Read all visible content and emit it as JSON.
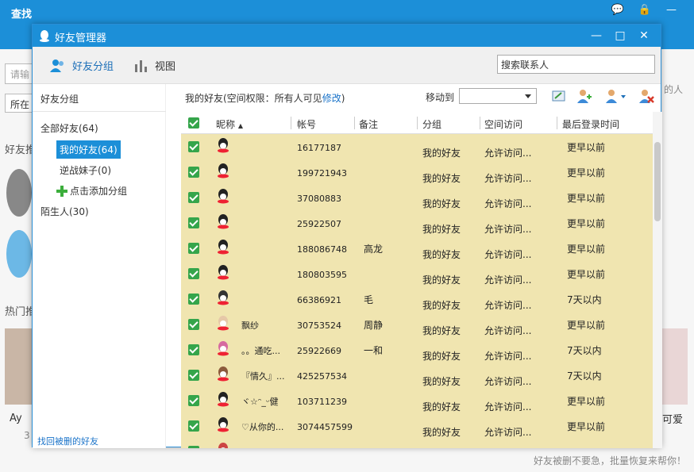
{
  "background": {
    "title": "查找",
    "search_placeholder": "请输",
    "select_value": "所在",
    "label_friend": "好友推",
    "label_hot": "热门推",
    "card_name": "Ay",
    "card_count": "3",
    "right_label": "的人",
    "right_card": "可爱",
    "bottom_tip": "好友被删不要急，批量恢复来帮你！"
  },
  "dialog": {
    "title": "好友管理器",
    "controls": [
      "—",
      "□",
      "✕"
    ]
  },
  "toolbar": {
    "group_label": "好友分组",
    "view_label": "视图",
    "search_value": "搜索联系人"
  },
  "sidebar": {
    "header": "好友分组",
    "all_friends": "全部好友(64)",
    "my_friends": "我的好友(64)",
    "group2": "逆战妹子(0)",
    "add_group": "点击添加分组",
    "strangers": "陌生人(30)",
    "footer": "找回被删的好友"
  },
  "main": {
    "title_prefix": "我的好友(空间权限：所有人可见",
    "title_link": "修改",
    "title_suffix": ")",
    "move_to": "移动到",
    "move_value": ""
  },
  "table": {
    "headers": [
      "昵称",
      "帐号",
      "备注",
      "分组",
      "空间访问",
      "最后登录时间"
    ],
    "rows": [
      {
        "nick": "",
        "account": "16177187",
        "remark": "",
        "group": "我的好友",
        "access": "允许访问...",
        "last": "更早以前"
      },
      {
        "nick": "",
        "account": "199721943",
        "remark": "",
        "group": "我的好友",
        "access": "允许访问...",
        "last": "更早以前"
      },
      {
        "nick": "",
        "account": "37080883",
        "remark": "",
        "group": "我的好友",
        "access": "允许访问...",
        "last": "更早以前"
      },
      {
        "nick": "",
        "account": "25922507",
        "remark": "",
        "group": "我的好友",
        "access": "允许访问...",
        "last": "更早以前"
      },
      {
        "nick": "",
        "account": "188086748",
        "remark": "高龙",
        "group": "我的好友",
        "access": "允许访问...",
        "last": "更早以前"
      },
      {
        "nick": "",
        "account": "180803595",
        "remark": "",
        "group": "我的好友",
        "access": "允许访问...",
        "last": "更早以前"
      },
      {
        "nick": "",
        "account": "66386921",
        "remark": "毛",
        "group": "我的好友",
        "access": "允许访问...",
        "last": "7天以内"
      },
      {
        "nick": "飘纱",
        "account": "30753524",
        "remark": "周静",
        "group": "我的好友",
        "access": "允许访问...",
        "last": "更早以前"
      },
      {
        "nick": "。。通吃...",
        "account": "25922669",
        "remark": "一和",
        "group": "我的好友",
        "access": "允许访问...",
        "last": "7天以内"
      },
      {
        "nick": "『情久』...",
        "account": "425257534",
        "remark": "",
        "group": "我的好友",
        "access": "允许访问...",
        "last": "7天以内"
      },
      {
        "nick": "ヾ☆ᵔ_ᵕ健",
        "account": "103711239",
        "remark": "",
        "group": "我的好友",
        "access": "允许访问...",
        "last": "更早以前"
      },
      {
        "nick": "♡从你的...",
        "account": "3074457599",
        "remark": "",
        "group": "我的好友",
        "access": "允许访问...",
        "last": "更早以前"
      },
      {
        "nick": "",
        "account": "",
        "remark": "",
        "group": "",
        "access": "",
        "last": ""
      }
    ]
  },
  "colors": {
    "accent": "#1c8fd8",
    "row_bg": "#f0e5b0",
    "check": "#35a54b",
    "link": "#1a73c9"
  }
}
